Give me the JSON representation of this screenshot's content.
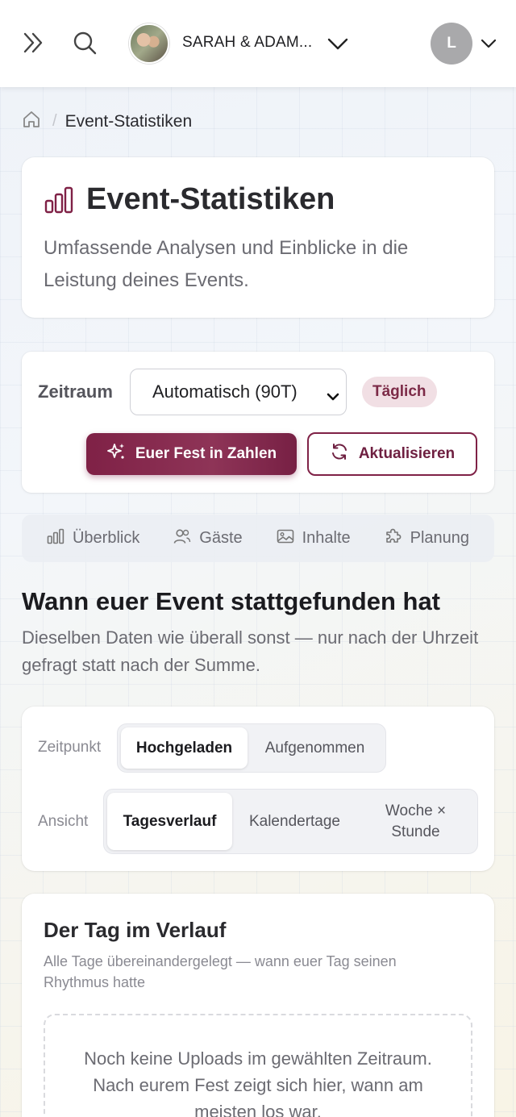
{
  "topbar": {
    "event_name": "SARAH & ADAM...",
    "user_initial": "L",
    "icons": [
      "double-chevron-right-icon",
      "search-icon",
      "chevron-down-icon"
    ]
  },
  "breadcrumb": {
    "current": "Event-Statistiken"
  },
  "hero": {
    "title": "Event-Statistiken",
    "description": "Umfassende Analysen und Einblicke in die Leistung deines Events."
  },
  "controls": {
    "zeitraum_label": "Zeitraum",
    "select_value": "Automatisch (90T)",
    "interval_badge": "Täglich",
    "primary_button": "Euer Fest in Zahlen",
    "refresh_button": "Aktualisieren"
  },
  "tabs": [
    {
      "label": "Überblick",
      "icon": "bar-chart-icon"
    },
    {
      "label": "Gäste",
      "icon": "users-icon"
    },
    {
      "label": "Inhalte",
      "icon": "image-icon"
    },
    {
      "label": "Planung",
      "icon": "puzzle-icon"
    }
  ],
  "section": {
    "title": "Wann euer Event stattgefunden hat",
    "description": "Dieselben Daten wie überall sonst — nur nach der Uhrzeit gefragt statt nach der Summe."
  },
  "filters": {
    "zeitpunkt_label": "Zeitpunkt",
    "zeitpunkt_options": [
      "Hochgeladen",
      "Aufgenommen"
    ],
    "ansicht_label": "Ansicht",
    "ansicht_options": [
      "Tagesverlauf",
      "Kalendertage",
      "Woche × Stunde"
    ]
  },
  "day_card": {
    "title": "Der Tag im Verlauf",
    "description": "Alle Tage übereinandergelegt — wann euer Tag seinen Rhythmus hatte",
    "empty_text": "Noch keine Uploads im gewählten Zeitraum. Nach eurem Fest zeigt sich hier, wann am meisten los war."
  },
  "colors": {
    "accent": "#7f2146",
    "badge_bg": "#f1dfe4"
  }
}
